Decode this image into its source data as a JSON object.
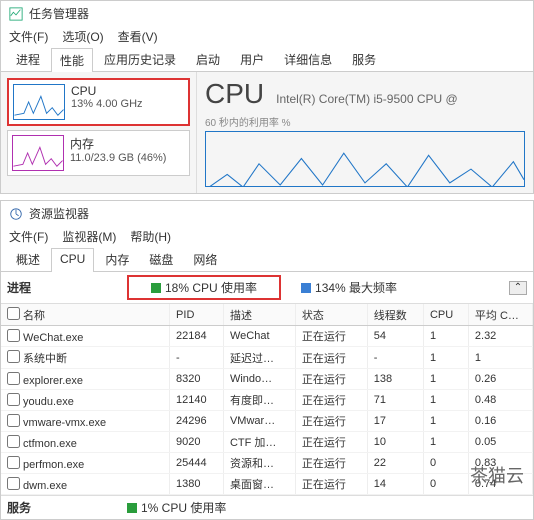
{
  "tm": {
    "title": "任务管理器",
    "menus": [
      "文件(F)",
      "选项(O)",
      "查看(V)"
    ],
    "tabs": [
      "进程",
      "性能",
      "应用历史记录",
      "启动",
      "用户",
      "详细信息",
      "服务"
    ],
    "activeTab": 1,
    "tiles": [
      {
        "name": "CPU",
        "sub": "13% 4.00 GHz",
        "hl": true,
        "color": "#2176c7"
      },
      {
        "name": "内存",
        "sub": "11.0/23.9 GB (46%)",
        "hl": false,
        "color": "#b030b0"
      }
    ],
    "main": {
      "title": "CPU",
      "subtitle": "Intel(R) Core(TM) i5-9500 CPU @",
      "chartLabel": "60 秒内的利用率 %"
    }
  },
  "rm": {
    "title": "资源监视器",
    "menus": [
      "文件(F)",
      "监视器(M)",
      "帮助(H)"
    ],
    "tabs": [
      "概述",
      "CPU",
      "内存",
      "磁盘",
      "网络"
    ],
    "activeTab": 1,
    "summary": {
      "label": "进程",
      "cpu": "18% CPU 使用率",
      "freq": "134% 最大频率"
    },
    "cols": [
      "名称",
      "PID",
      "描述",
      "状态",
      "线程数",
      "CPU",
      "平均 C…"
    ],
    "rows": [
      {
        "n": "WeChat.exe",
        "p": "22184",
        "d": "WeChat",
        "s": "正在运行",
        "t": "54",
        "c": "1",
        "a": "2.32"
      },
      {
        "n": "系统中断",
        "p": "-",
        "d": "延迟过…",
        "s": "正在运行",
        "t": "-",
        "c": "1",
        "a": "1"
      },
      {
        "n": "explorer.exe",
        "p": "8320",
        "d": "Windo…",
        "s": "正在运行",
        "t": "138",
        "c": "1",
        "a": "0.26"
      },
      {
        "n": "youdu.exe",
        "p": "12140",
        "d": "有度即…",
        "s": "正在运行",
        "t": "71",
        "c": "1",
        "a": "0.48"
      },
      {
        "n": "vmware-vmx.exe",
        "p": "24296",
        "d": "VMwar…",
        "s": "正在运行",
        "t": "17",
        "c": "1",
        "a": "0.16"
      },
      {
        "n": "ctfmon.exe",
        "p": "9020",
        "d": "CTF 加…",
        "s": "正在运行",
        "t": "10",
        "c": "1",
        "a": "0.05"
      },
      {
        "n": "perfmon.exe",
        "p": "25444",
        "d": "资源和…",
        "s": "正在运行",
        "t": "22",
        "c": "0",
        "a": "0.83"
      },
      {
        "n": "dwm.exe",
        "p": "1380",
        "d": "桌面窗…",
        "s": "正在运行",
        "t": "14",
        "c": "0",
        "a": "0.74",
        "dim": true
      }
    ],
    "svc": {
      "label": "服务",
      "cpu": "1% CPU 使用率"
    }
  },
  "watermark": "茶猫云"
}
